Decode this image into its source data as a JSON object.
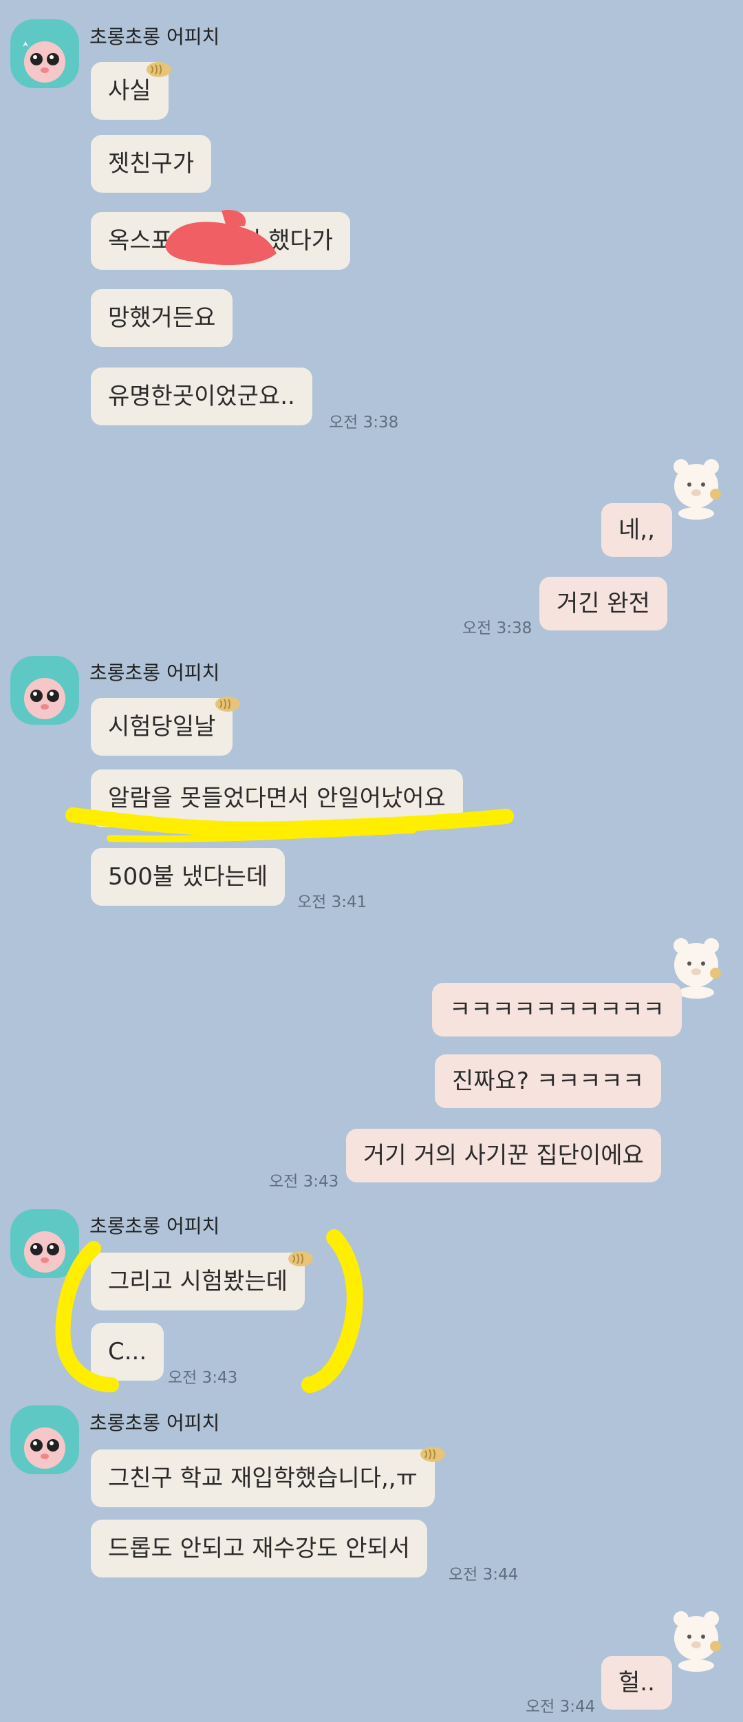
{
  "colors": {
    "background": "#b0c3d9",
    "incoming_bubble": "#f1ede4",
    "outgoing_bubble": "#f6e3de",
    "highlight_yellow": "#ffee00",
    "redaction": "#ef5f63",
    "avatar": "#5ec8c4"
  },
  "sender_name": "초롱초롱 어피치",
  "groups": [
    {
      "name": "초롱초롱 어피치",
      "messages": [
        "사실",
        "젯친구가",
        "옥스포",
        "에서 했다가",
        "망했거든요",
        "유명한곳이었군요.."
      ],
      "time": "오전 3:38"
    },
    {
      "messages": [
        "네,,",
        "거긴 완전"
      ],
      "time": "오전 3:38"
    },
    {
      "name": "초롱초롱 어피치",
      "messages": [
        "시험당일날",
        "알람을 못들었다면서 안일어났어요",
        "500불 냈다는데"
      ],
      "time": "오전 3:41"
    },
    {
      "messages": [
        "ㅋㅋㅋㅋㅋㅋㅋㅋㅋㅋ",
        "진짜요? ㅋㅋㅋㅋㅋ",
        "거기 거의 사기꾼 집단이에요"
      ],
      "time": "오전 3:43"
    },
    {
      "name": "초롱초롱 어피치",
      "messages": [
        "그리고 시험봤는데",
        "C..."
      ],
      "time": "오전 3:43"
    },
    {
      "name": "초롱초롱 어피치",
      "messages": [
        "그친구 학교 재입학했습니다,,ㅠ",
        "드롭도 안되고 재수강도 안되서"
      ],
      "time": "오전 3:44"
    },
    {
      "messages": [
        "헐.."
      ],
      "time": "오전 3:44"
    }
  ]
}
